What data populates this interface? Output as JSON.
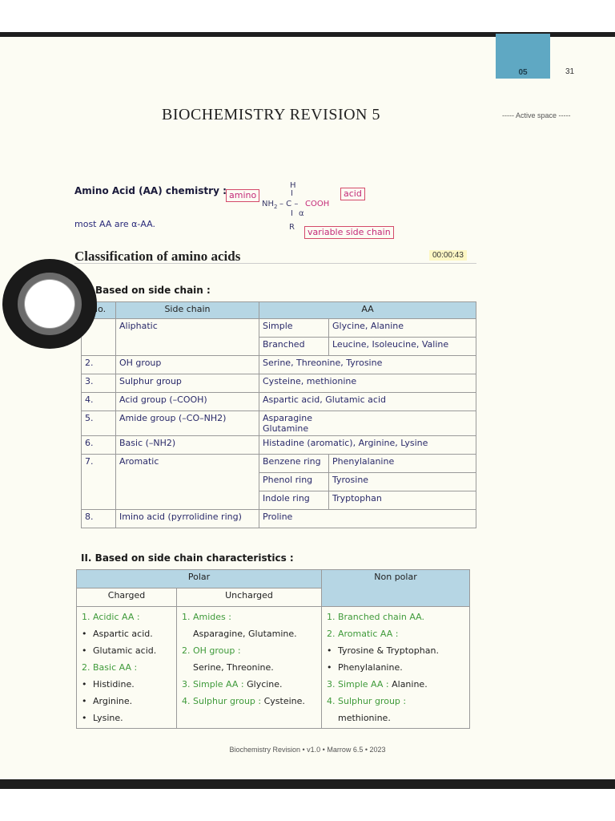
{
  "header": {
    "tab": "05",
    "page_number": "31",
    "title": "BIOCHEMISTRY REVISION 5",
    "active_space": "----- Active space -----"
  },
  "aa_chemistry": {
    "heading": "Amino Acid (AA) chemistry :",
    "amino_label": "amino",
    "acid_label": "acid",
    "side_chain_label": "variable side chain",
    "structure": {
      "h": "H",
      "bond_top": "I",
      "nh2": "NH",
      "sub2": "2",
      "c": "– C –",
      "cooh": "COOH",
      "alpha": "α",
      "bond_bottom": "I",
      "r": "R"
    },
    "note": "most AA are α-AA."
  },
  "classification": {
    "title": "Classification of amino acids",
    "timer": "00:00:43"
  },
  "table1": {
    "heading": "Based on side chain :",
    "col_no": "No.",
    "col_side": "Side chain",
    "col_aa": "AA",
    "aliphatic": {
      "label": "Aliphatic",
      "simple": "Simple",
      "simple_aa": "Glycine, Alanine",
      "branched": "Branched",
      "branched_aa": "Leucine, Isoleucine, Valine"
    },
    "rows": [
      {
        "no": "2.",
        "side": "OH group",
        "aa": "Serine, Threonine, Tyrosine"
      },
      {
        "no": "3.",
        "side": "Sulphur group",
        "aa": "Cysteine, methionine"
      },
      {
        "no": "4.",
        "side": "Acid group (–COOH)",
        "aa": "Aspartic acid, Glutamic acid"
      },
      {
        "no": "5.",
        "side": "Amide group (–CO–NH2)",
        "aa": "Asparagine",
        "aa2": "Glutamine"
      },
      {
        "no": "6.",
        "side": "Basic (–NH2)",
        "aa": "Histadine (aromatic), Arginine, Lysine"
      }
    ],
    "aromatic": {
      "no": "7.",
      "label": "Aromatic",
      "benzene": "Benzene ring",
      "benzene_aa": "Phenylalanine",
      "phenol": "Phenol ring",
      "phenol_aa": "Tyrosine",
      "indole": "Indole ring",
      "indole_aa": "Tryptophan"
    },
    "imino": {
      "no": "8.",
      "side": "Imino acid (pyrrolidine ring)",
      "aa": "Proline"
    }
  },
  "table2": {
    "heading": "II. Based on side chain characteristics :",
    "polar": "Polar",
    "non_polar": "Non polar",
    "charged": "Charged",
    "uncharged": "Uncharged",
    "charged_items": {
      "acidic": "1. Acidic AA :",
      "aspartic": "Aspartic acid.",
      "glutamic": "Glutamic acid.",
      "basic": "2. Basic AA :",
      "histidine": "Histidine.",
      "arginine": "Arginine.",
      "lysine": "Lysine."
    },
    "uncharged_items": {
      "amides": "1. Amides :",
      "amides_aa": "Asparagine, Glutamine.",
      "oh": "2. OH group :",
      "oh_aa": "Serine, Threonine.",
      "simple": "3. Simple AA :",
      "simple_aa": "Glycine.",
      "sulphur": "4. Sulphur group :",
      "sulphur_aa": "Cysteine."
    },
    "nonpolar_items": {
      "branched": "1. Branched chain AA.",
      "aromatic": "2. Aromatic AA :",
      "tyr_trp": "Tyrosine & Tryptophan.",
      "phe": "Phenylalanine.",
      "simple": "3. Simple AA :",
      "simple_aa": "Alanine.",
      "sulphur": "4. Sulphur group :",
      "sulphur_aa": "methionine."
    }
  },
  "footer": "Biochemistry Revision • v1.0 • Marrow 6.5 • 2023"
}
